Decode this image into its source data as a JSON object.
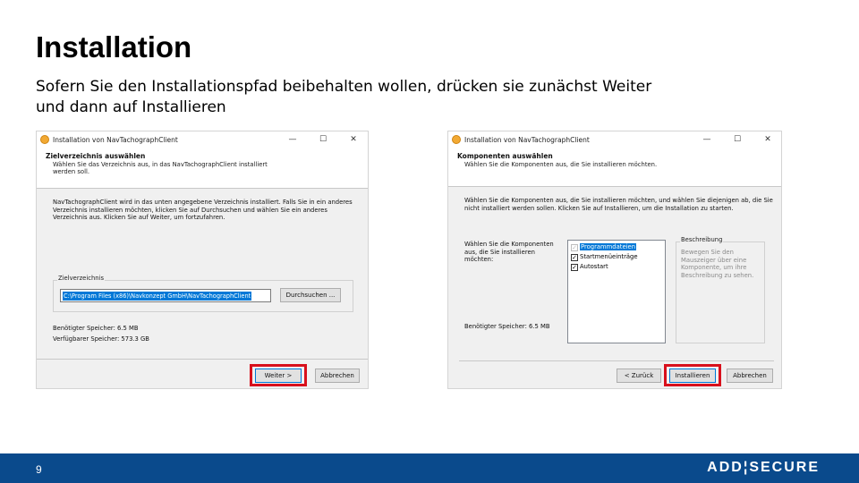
{
  "slide": {
    "title": "Installation",
    "subtitle": "Sofern Sie den Installationspfad beibehalten wollen, drücken sie zunächst Weiter und dann auf Installieren",
    "page_number": "9",
    "logo_text": "ADD¦SECURE"
  },
  "dialog_left": {
    "title": "Installation von NavTachographClient",
    "titlebar_buttons": {
      "minimize": "—",
      "maximize": "☐",
      "close": "✕"
    },
    "header_title": "Zielverzeichnis auswählen",
    "header_sub": "Wählen Sie das Verzeichnis aus, in das NavTachographClient installiert werden soll.",
    "body": "NavTachographClient wird in das unten angegebene Verzeichnis installiert. Falls Sie in ein anderes Verzeichnis installieren möchten, klicken Sie auf Durchsuchen und wählen Sie ein anderes Verzeichnis aus. Klicken Sie auf Weiter, um fortzufahren.",
    "group_label": "Zielverzeichnis",
    "path_value": "C:\\Program Files (x86)\\Navkonzept GmbH\\NavTachographClient",
    "browse_button": "Durchsuchen ...",
    "space_required": "Benötigter Speicher: 6.5 MB",
    "space_available": "Verfügbarer Speicher: 573.3 GB",
    "next_button": "Weiter >",
    "cancel_button": "Abbrechen"
  },
  "dialog_right": {
    "title": "Installation von NavTachographClient",
    "titlebar_buttons": {
      "minimize": "—",
      "maximize": "☐",
      "close": "✕"
    },
    "header_title": "Komponenten auswählen",
    "header_sub": "Wählen Sie die Komponenten aus, die Sie installieren möchten.",
    "body": "Wählen Sie die Komponenten aus, die Sie installieren möchten, und wählen Sie diejenigen ab, die Sie nicht installiert werden sollen. Klicken Sie auf Installieren, um die Installation zu starten.",
    "components_label": "Wählen Sie die Komponenten aus, die Sie installieren möchten:",
    "components": [
      {
        "label": "Programmdateien",
        "checked": true,
        "disabled": true,
        "selected": true
      },
      {
        "label": "Startmenüeinträge",
        "checked": true,
        "disabled": false,
        "selected": false
      },
      {
        "label": "Autostart",
        "checked": true,
        "disabled": false,
        "selected": false
      }
    ],
    "description_label": "Beschreibung",
    "description_text": "Bewegen Sie den Mauszeiger über eine Komponente, um ihre Beschreibung zu sehen.",
    "space_required": "Benötigter Speicher: 6.5 MB",
    "back_button": "< Zurück",
    "install_button": "Installieren",
    "cancel_button": "Abbrechen"
  },
  "colors": {
    "footer": "#0a4a8c",
    "highlight": "#d8101c",
    "selection": "#0078d7"
  }
}
